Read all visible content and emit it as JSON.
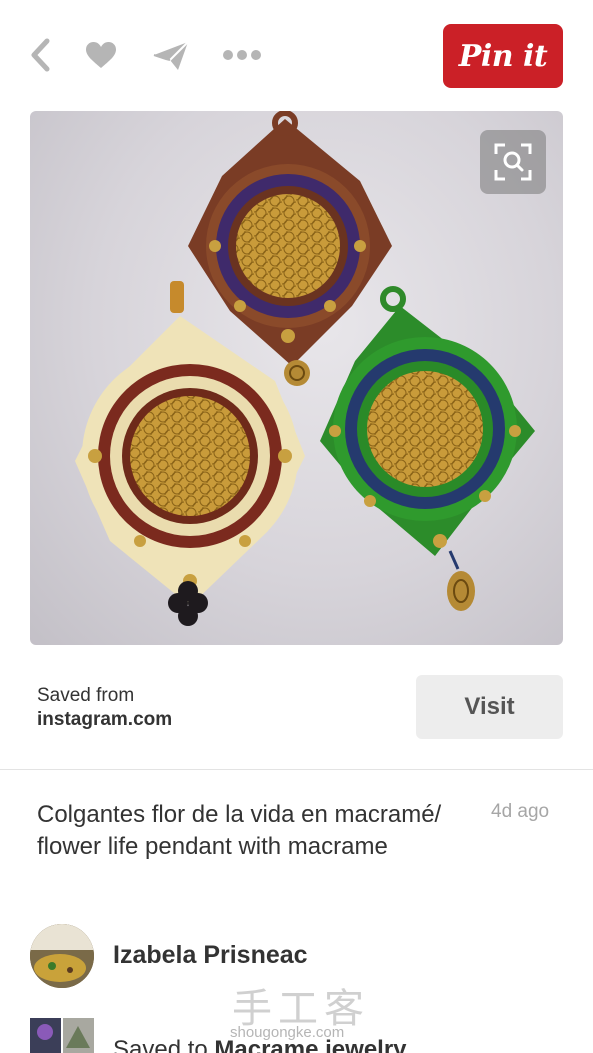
{
  "toolbar": {
    "icons": [
      "back-icon",
      "heart-icon",
      "send-icon",
      "more-icon"
    ],
    "pin_button_label": "Pin it",
    "pin_button_color": "#cb2027"
  },
  "image": {
    "zoom_icon": "zoom-scan-icon"
  },
  "source": {
    "saved_from_label": "Saved from",
    "domain": "instagram.com",
    "visit_label": "Visit"
  },
  "pin": {
    "description": "Colgantes flor de la vida en macramé/ flower life pendant with macrame",
    "age": "4d ago"
  },
  "pinner": {
    "name": "Izabela Prisneac"
  },
  "board": {
    "prefix": "Saved to ",
    "name": "Macrame jewelry"
  },
  "watermark": {
    "chinese": "手工客",
    "url": "shougongke.com"
  },
  "colors": {
    "accent": "#cb2027",
    "text": "#333333",
    "muted": "#a6a6a6",
    "icon": "#b5b5b5"
  }
}
